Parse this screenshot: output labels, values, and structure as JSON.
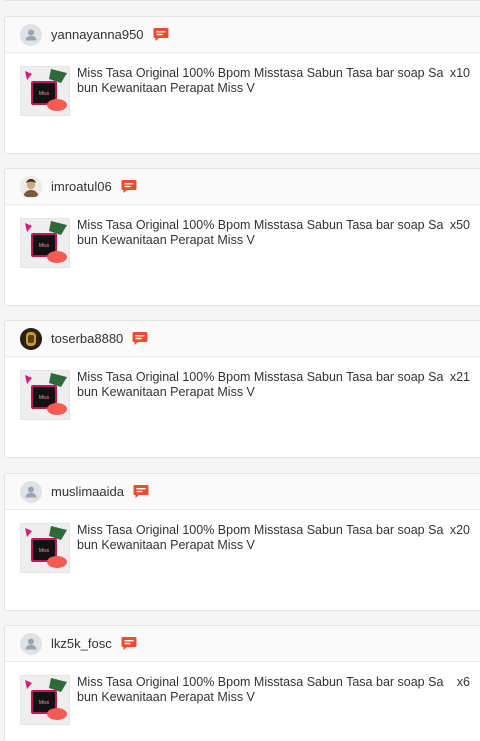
{
  "orders": [
    {
      "username": "yannayanna950",
      "avatar": "default",
      "product_title": "Miss Tasa Original 100% Bpom Misstasa Sabun Tasa bar soap Sabun Kewanitaan Perapat Miss V",
      "quantity": "x10"
    },
    {
      "username": "imroatul06",
      "avatar": "photo",
      "product_title": "Miss Tasa Original 100% Bpom Misstasa Sabun Tasa bar soap Sabun Kewanitaan Perapat Miss V",
      "quantity": "x50"
    },
    {
      "username": "toserba8880",
      "avatar": "store",
      "product_title": "Miss Tasa Original 100% Bpom Misstasa Sabun Tasa bar soap Sabun Kewanitaan Perapat Miss V",
      "quantity": "x21"
    },
    {
      "username": "muslimaaida",
      "avatar": "default",
      "product_title": "Miss Tasa Original 100% Bpom Misstasa Sabun Tasa bar soap Sabun Kewanitaan Perapat Miss V",
      "quantity": "x20"
    },
    {
      "username": "lkz5k_fosc",
      "avatar": "default",
      "product_title": "Miss Tasa Original 100% Bpom Misstasa Sabun Tasa bar soap Sabun Kewanitaan Perapat Miss V",
      "quantity": "x6"
    }
  ],
  "colors": {
    "chat_icon": "#ee4d2d",
    "card_bg": "#ffffff",
    "page_bg": "#f5f5f5"
  },
  "icons": {
    "chat": "chat-bubble-icon",
    "default_avatar": "user-icon"
  }
}
